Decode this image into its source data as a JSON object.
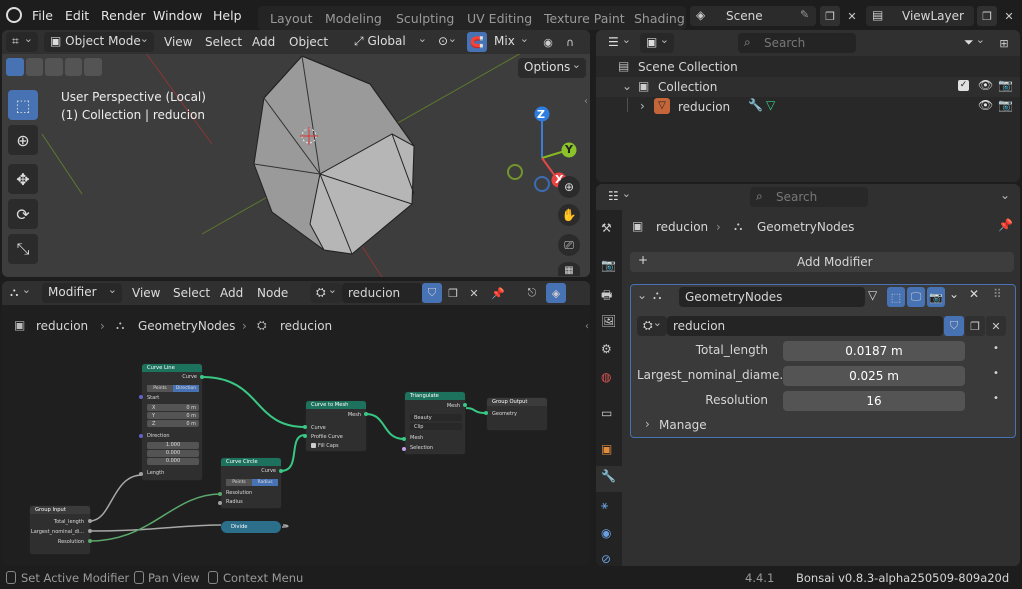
{
  "topbar": {
    "menus": [
      "File",
      "Edit",
      "Render",
      "Window",
      "Help"
    ],
    "workspaces": [
      "Layout",
      "Modeling",
      "Sculpting",
      "UV Editing",
      "Texture Paint",
      "Shading"
    ],
    "scene": "Scene",
    "view_layer": "ViewLayer"
  },
  "viewport": {
    "mode": "Object Mode",
    "menus": [
      "View",
      "Select",
      "Add",
      "Object"
    ],
    "transform": "Global",
    "snap_mode": "Mix",
    "options_label": "Options",
    "overlay_line1": "User Perspective (Local)",
    "overlay_line2": "(1) Collection | reducion",
    "gizmo": {
      "z": "Z",
      "y": "Y",
      "x": "X"
    }
  },
  "node_editor": {
    "editor_type": "Modifier",
    "menus": [
      "View",
      "Select",
      "Add",
      "Node"
    ],
    "node_group": "reducion",
    "breadcrumb": [
      "reducion",
      "GeometryNodes",
      "reducion"
    ],
    "nodes": {
      "curve_line": {
        "title": "Curve Line",
        "out": "Curve",
        "mode_a": "Points",
        "mode_b": "Direction",
        "start": "Start",
        "x": "X",
        "y": "Y",
        "z": "Z",
        "xv": "0 m",
        "yv": "0 m",
        "zv": "0 m",
        "direction": "Direction",
        "d1": "1.000",
        "d2": "0.000",
        "d3": "0.000",
        "length": "Length"
      },
      "curve_circle": {
        "title": "Curve Circle",
        "out": "Curve",
        "mode_a": "Points",
        "mode_b": "Radius",
        "resolution": "Resolution",
        "radius": "Radius"
      },
      "curve_to_mesh": {
        "title": "Curve to Mesh",
        "out": "Mesh",
        "curve": "Curve",
        "profile": "Profile Curve",
        "fill": "Fill Caps"
      },
      "triangulate": {
        "title": "Triangulate",
        "out": "Mesh",
        "opt1": "Beauty",
        "opt2": "Clip",
        "mesh": "Mesh",
        "selection": "Selection"
      },
      "group_output": {
        "title": "Group Output",
        "geometry": "Geometry"
      },
      "group_input": {
        "title": "Group Input",
        "total": "Total_length",
        "largest": "Largest_nominal_di...",
        "resolution": "Resolution"
      },
      "divide": {
        "title": "Divide"
      }
    }
  },
  "outliner": {
    "search_placeholder": "Search",
    "scene_collection": "Scene Collection",
    "collection": "Collection",
    "object": "reducion"
  },
  "properties": {
    "search_placeholder": "Search",
    "breadcrumb_obj": "reducion",
    "breadcrumb_mod": "GeometryNodes",
    "add_modifier": "Add Modifier",
    "modifier_name": "GeometryNodes",
    "node_group": "reducion",
    "inputs": [
      {
        "label": "Total_length",
        "value": "0.0187 m"
      },
      {
        "label": "Largest_nominal_diame...",
        "value": "0.025 m"
      },
      {
        "label": "Resolution",
        "value": "16"
      }
    ],
    "manage": "Manage"
  },
  "status": {
    "hint1": "Set Active Modifier",
    "hint2": "Pan View",
    "hint3": "Context Menu",
    "version": "4.4.1",
    "addon": "Bonsai v0.8.3-alpha250509-809a20d"
  },
  "colors": {
    "accent_blue": "#4772b3",
    "node_header_green": "#1d725e",
    "node_header_teal": "#2b6f8a",
    "link_green": "#39c884"
  }
}
